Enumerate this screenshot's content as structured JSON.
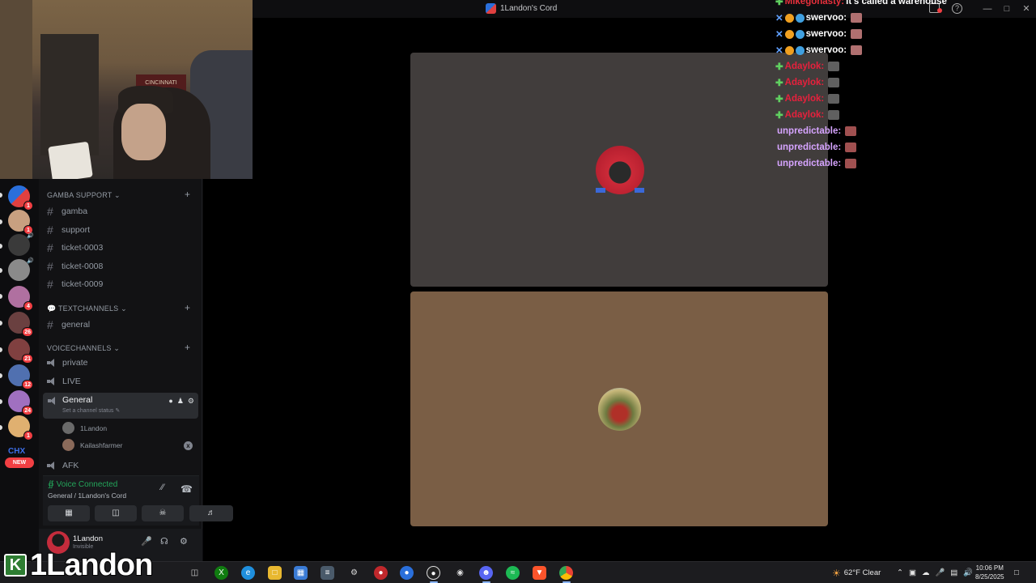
{
  "window": {
    "title": "1Landon's Cord"
  },
  "webcam": {
    "banner_text": "CINCINNATI"
  },
  "server_rail": {
    "badges": [
      "1",
      "1",
      "4",
      "26",
      "21",
      "12",
      "24",
      "1"
    ],
    "chx_label": "CHX",
    "new_label": "NEW"
  },
  "sidebar": {
    "categories": {
      "gamba_support": "GAMBA SUPPORT",
      "text_channels": "TEXTCHANNELS",
      "voice_channels": "VOICECHANNELS"
    },
    "text_channels_support": [
      "gamba",
      "support",
      "ticket-0003",
      "ticket-0008",
      "ticket-0009"
    ],
    "text_channels": [
      "general"
    ],
    "voice_channels": [
      "private",
      "LIVE"
    ],
    "active_voice": {
      "name": "General",
      "status_placeholder": "Set a channel status"
    },
    "voice_users": [
      "1Landon",
      "Kailashfarmer"
    ],
    "afk_channel": "AFK"
  },
  "voice_panel": {
    "status": "Voice Connected",
    "location": "General / 1Landon's Cord"
  },
  "user_panel": {
    "username": "1Landon",
    "status": "Invisible"
  },
  "chat": [
    {
      "user": "Mikegonasty:",
      "text": "It's called a warehouse",
      "color": "#e8303c"
    },
    {
      "user": "swervoo:",
      "text": "",
      "color": "#ffffff"
    },
    {
      "user": "swervoo:",
      "text": "",
      "color": "#ffffff"
    },
    {
      "user": "swervoo:",
      "text": "",
      "color": "#ffffff"
    },
    {
      "user": "Adaylok:",
      "text": "",
      "color": "#e8203c"
    },
    {
      "user": "Adaylok:",
      "text": "",
      "color": "#e8203c"
    },
    {
      "user": "Adaylok:",
      "text": "",
      "color": "#e8203c"
    },
    {
      "user": "Adaylok:",
      "text": "",
      "color": "#e8203c"
    },
    {
      "user": "unpredictable:",
      "text": "",
      "color": "#d6a4ff"
    },
    {
      "user": "unpredictable:",
      "text": "",
      "color": "#d6a4ff"
    },
    {
      "user": "unpredictable:",
      "text": "",
      "color": "#d6a4ff"
    }
  ],
  "overlay": {
    "streamer_name": "1Landon",
    "logo_letter": "K"
  },
  "taskbar": {
    "weather": "62°F Clear",
    "time": "10:06 PM",
    "date": "8/25/2025"
  }
}
